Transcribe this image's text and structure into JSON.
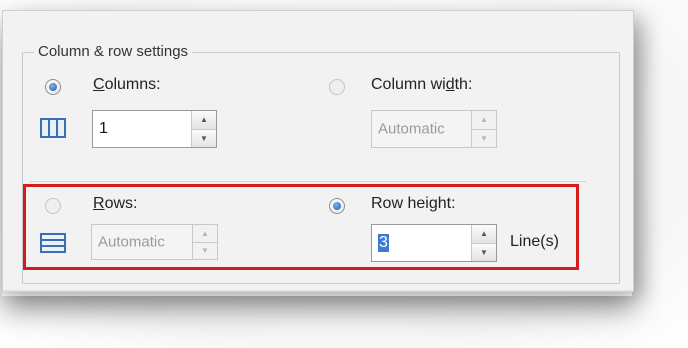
{
  "group": {
    "title": "Column & row settings"
  },
  "columns": {
    "radio_label_prefix": "",
    "radio_label_mnemonic": "C",
    "radio_label_rest": "olumns:",
    "value": "1",
    "checked": true,
    "icon": "columns-icon"
  },
  "column_width": {
    "label_pre": "Column wi",
    "label_mnemonic": "d",
    "label_post": "th:",
    "value": "Automatic",
    "checked": false
  },
  "rows": {
    "radio_label_mnemonic": "R",
    "radio_label_rest": "ows:",
    "value": "Automatic",
    "checked": false,
    "icon": "rows-icon"
  },
  "row_height": {
    "label_pre": "Row hei",
    "label_mnemonic": "g",
    "label_post": "ht:",
    "value": "3",
    "checked": true,
    "unit": "Line(s)"
  },
  "highlight_color": "#d31c1c"
}
